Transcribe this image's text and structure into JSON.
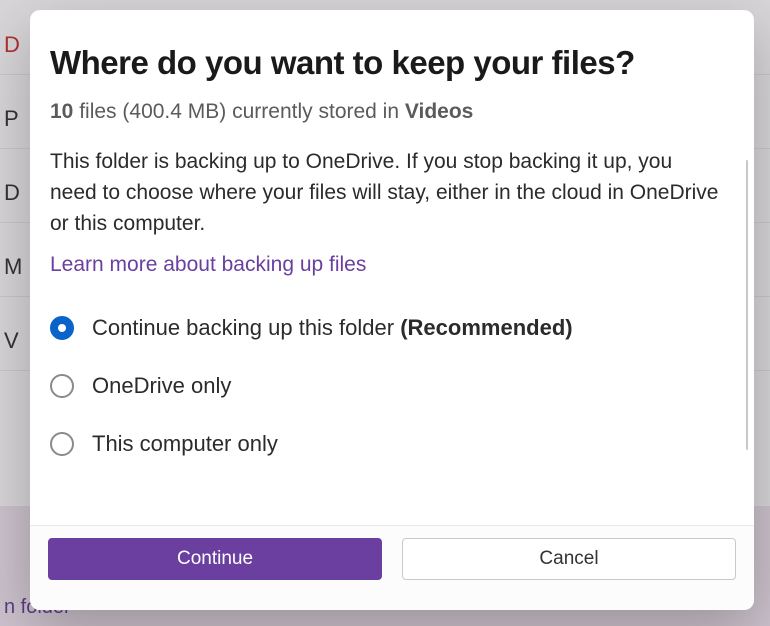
{
  "dialog": {
    "title": "Where do you want to keep your files?",
    "file_count": "10",
    "file_size": "(400.4 MB)",
    "stored_label": "files",
    "stored_in_label": "currently stored in",
    "folder_name": "Videos",
    "description": "This folder is backing up to OneDrive. If you stop backing it up, you need to choose where your files will stay, either in the cloud in OneDrive or this computer.",
    "learn_more": "Learn more about backing up files"
  },
  "options": [
    {
      "label": "Continue backing up this folder",
      "suffix": "(Recommended)",
      "selected": true
    },
    {
      "label": "OneDrive only",
      "suffix": "",
      "selected": false
    },
    {
      "label": "This computer only",
      "suffix": "",
      "selected": false
    }
  ],
  "buttons": {
    "continue": "Continue",
    "cancel": "Cancel"
  },
  "background": {
    "letters": [
      "D",
      "P",
      "D",
      "M",
      "V"
    ],
    "bottom_text": "n folder"
  }
}
